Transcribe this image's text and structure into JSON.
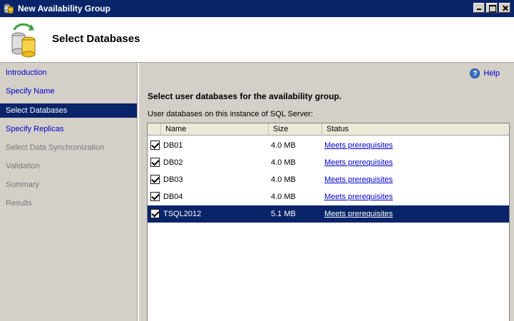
{
  "window": {
    "title": "New Availability Group"
  },
  "header": {
    "title": "Select Databases"
  },
  "nav": {
    "items": [
      {
        "label": "Introduction",
        "state": "link"
      },
      {
        "label": "Specify Name",
        "state": "link"
      },
      {
        "label": "Select Databases",
        "state": "selected"
      },
      {
        "label": "Specify Replicas",
        "state": "link"
      },
      {
        "label": "Select Data Synchronization",
        "state": "disabled"
      },
      {
        "label": "Validation",
        "state": "disabled"
      },
      {
        "label": "Summary",
        "state": "disabled"
      },
      {
        "label": "Results",
        "state": "disabled"
      }
    ]
  },
  "content": {
    "help": "Help",
    "instruction": "Select user databases for the availability group.",
    "list_label": "User databases on this instance of SQL Server:"
  },
  "table": {
    "columns": [
      "Name",
      "Size",
      "Status"
    ],
    "rows": [
      {
        "name": "DB01",
        "size": "4.0 MB",
        "status": "Meets prerequisites",
        "checked": true
      },
      {
        "name": "DB02",
        "size": "4.0 MB",
        "status": "Meets prerequisites",
        "checked": true
      },
      {
        "name": "DB03",
        "size": "4.0 MB",
        "status": "Meets prerequisites",
        "checked": true
      },
      {
        "name": "DB04",
        "size": "4.0 MB",
        "status": "Meets prerequisites",
        "checked": true
      },
      {
        "name": "TSQL2012",
        "size": "5.1 MB",
        "status": "Meets prerequisites",
        "checked": true,
        "selected": true
      }
    ]
  },
  "colors": {
    "titlebar": "#0a246a",
    "selection": "#0a246a",
    "link": "#0000cc",
    "panel": "#d4d0c8"
  }
}
